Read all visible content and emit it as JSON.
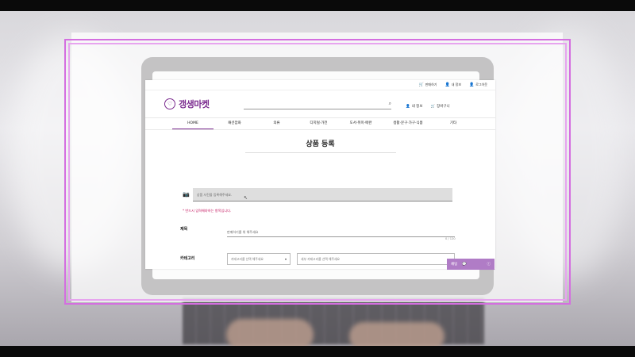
{
  "util_links": [
    "판매하기",
    "내 정보",
    "로그아웃"
  ],
  "logo": {
    "text": "갱생마켓",
    "icon": "hanger-icon"
  },
  "search": {
    "icon": "search-icon"
  },
  "header_links": [
    "내 정보",
    "장바구니"
  ],
  "nav": [
    "HOME",
    "패션잡화",
    "의류",
    "디지털·가전",
    "도서·취미·애완",
    "생활·문구·가구·식품",
    "기타"
  ],
  "nav_active": "HOME",
  "page_title": "상품 등록",
  "photo": {
    "placeholder": "상품 사진을 등록해주세요.",
    "icon": "camera-icon"
  },
  "required_note": "* 반드시 입력해야하는 항목입니다.",
  "fields": {
    "title_label": "제목",
    "title_placeholder": "판매하기를 위 해주세요",
    "title_counter": "0 / 120",
    "category_label": "카테고리",
    "category_main": "카테고리를 선택 해주세요",
    "category_sub": "세부 카테고리를 선택 해주세요"
  },
  "chat_widget": {
    "label": "채팅",
    "icons": [
      "chat-icon",
      "help-icon"
    ]
  },
  "colors": {
    "brand": "#7b2b8f",
    "frame": "#d46ee0",
    "required": "#c3135d",
    "chat": "#b07cc6"
  }
}
